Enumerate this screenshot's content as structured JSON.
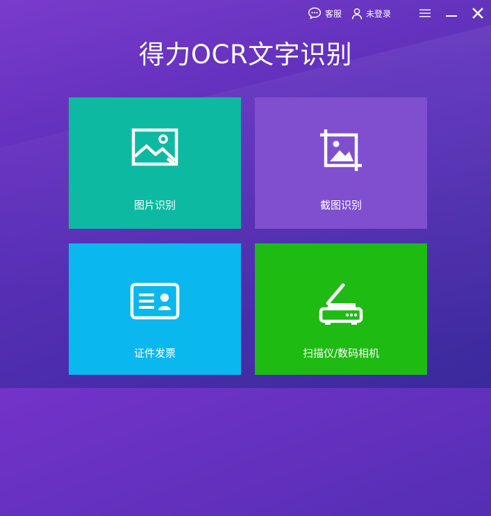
{
  "app": {
    "title": "得力OCR文字识别"
  },
  "topbar": {
    "support_label": "客服",
    "support_icon": "chat-bubble-icon",
    "login_label": "未登录",
    "login_icon": "user-icon",
    "menu_icon": "menu-icon",
    "minimize_icon": "minimize-icon",
    "close_icon": "close-icon"
  },
  "tiles": [
    {
      "label": "图片识别",
      "icon": "image-icon",
      "color": "#0eb9a1"
    },
    {
      "label": "截图识别",
      "icon": "crop-image-icon",
      "color": "#7f4fd0"
    },
    {
      "label": "证件发票",
      "icon": "id-card-icon",
      "color": "#0ab7ee"
    },
    {
      "label": "扫描仪/数码相机",
      "icon": "scanner-icon",
      "color": "#1ebb13"
    }
  ],
  "colors": {
    "background_start": "#7433c9",
    "background_end": "#3a2a9c"
  }
}
